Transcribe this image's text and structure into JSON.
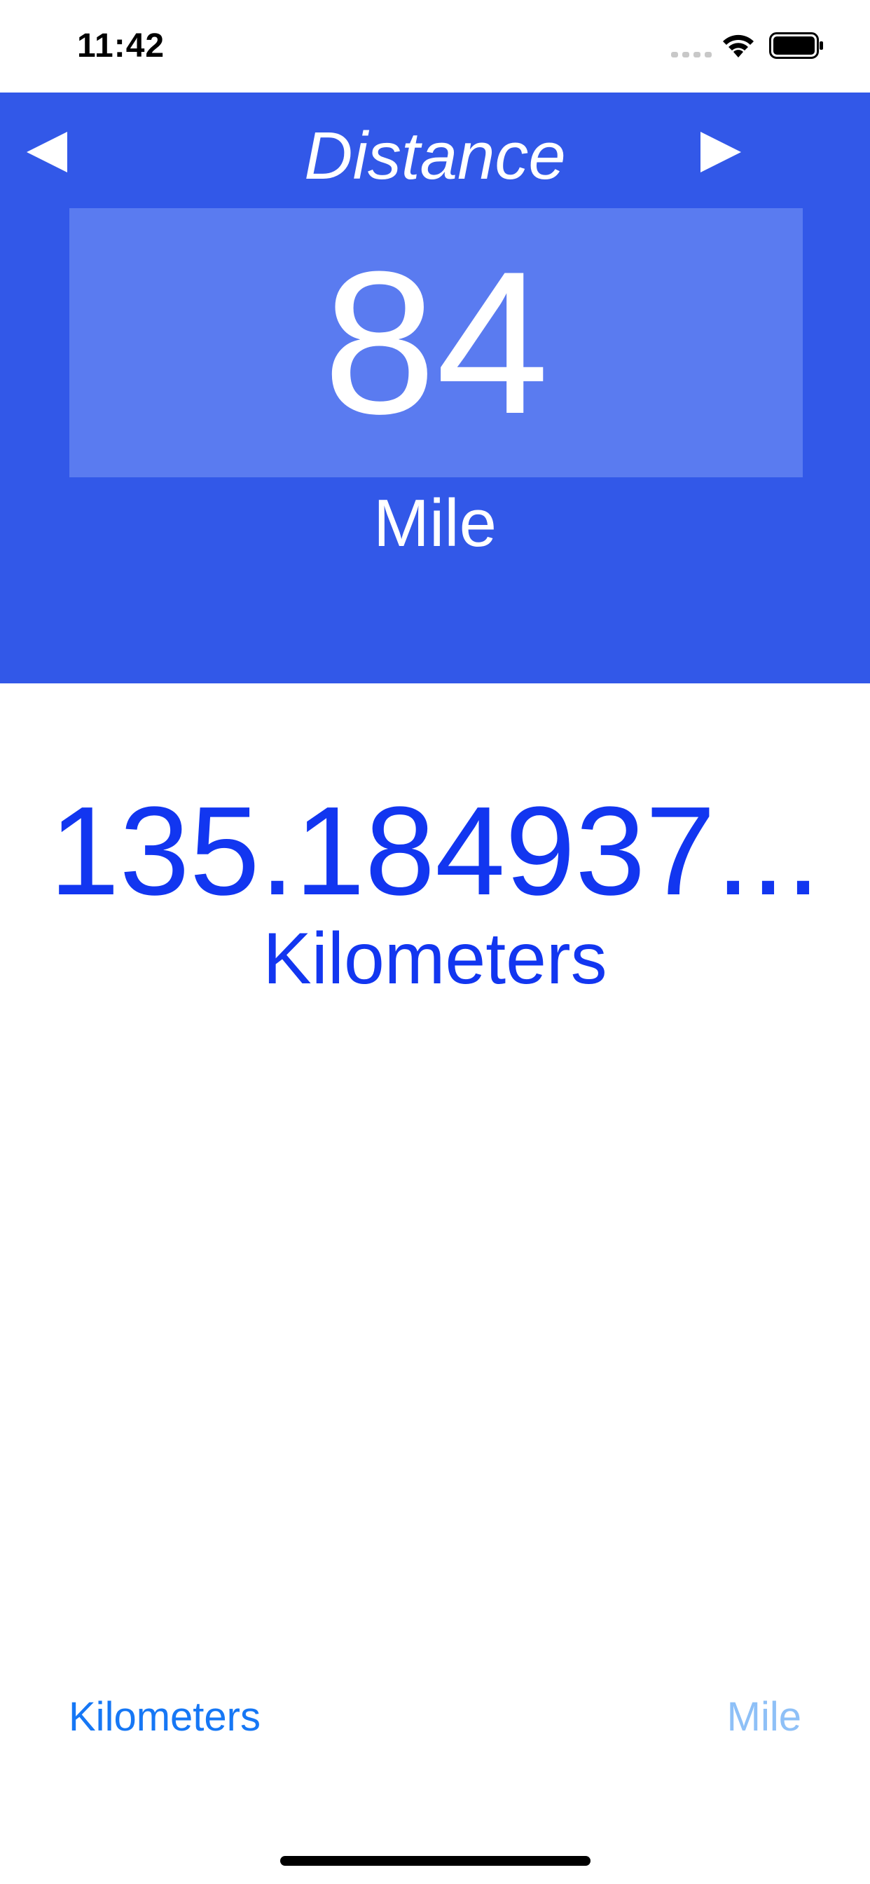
{
  "status_bar": {
    "time": "11:42"
  },
  "header": {
    "title": "Distance",
    "input_value": "84",
    "input_unit": "Mile",
    "background_color": "#3258e8",
    "prev_icon": "triangle-left-icon",
    "next_icon": "triangle-right-icon"
  },
  "result": {
    "value": "135.184937...",
    "unit": "Kilometers",
    "color": "#1236f0"
  },
  "unit_picker": {
    "left_label": "Kilometers",
    "right_label": "Mile"
  }
}
